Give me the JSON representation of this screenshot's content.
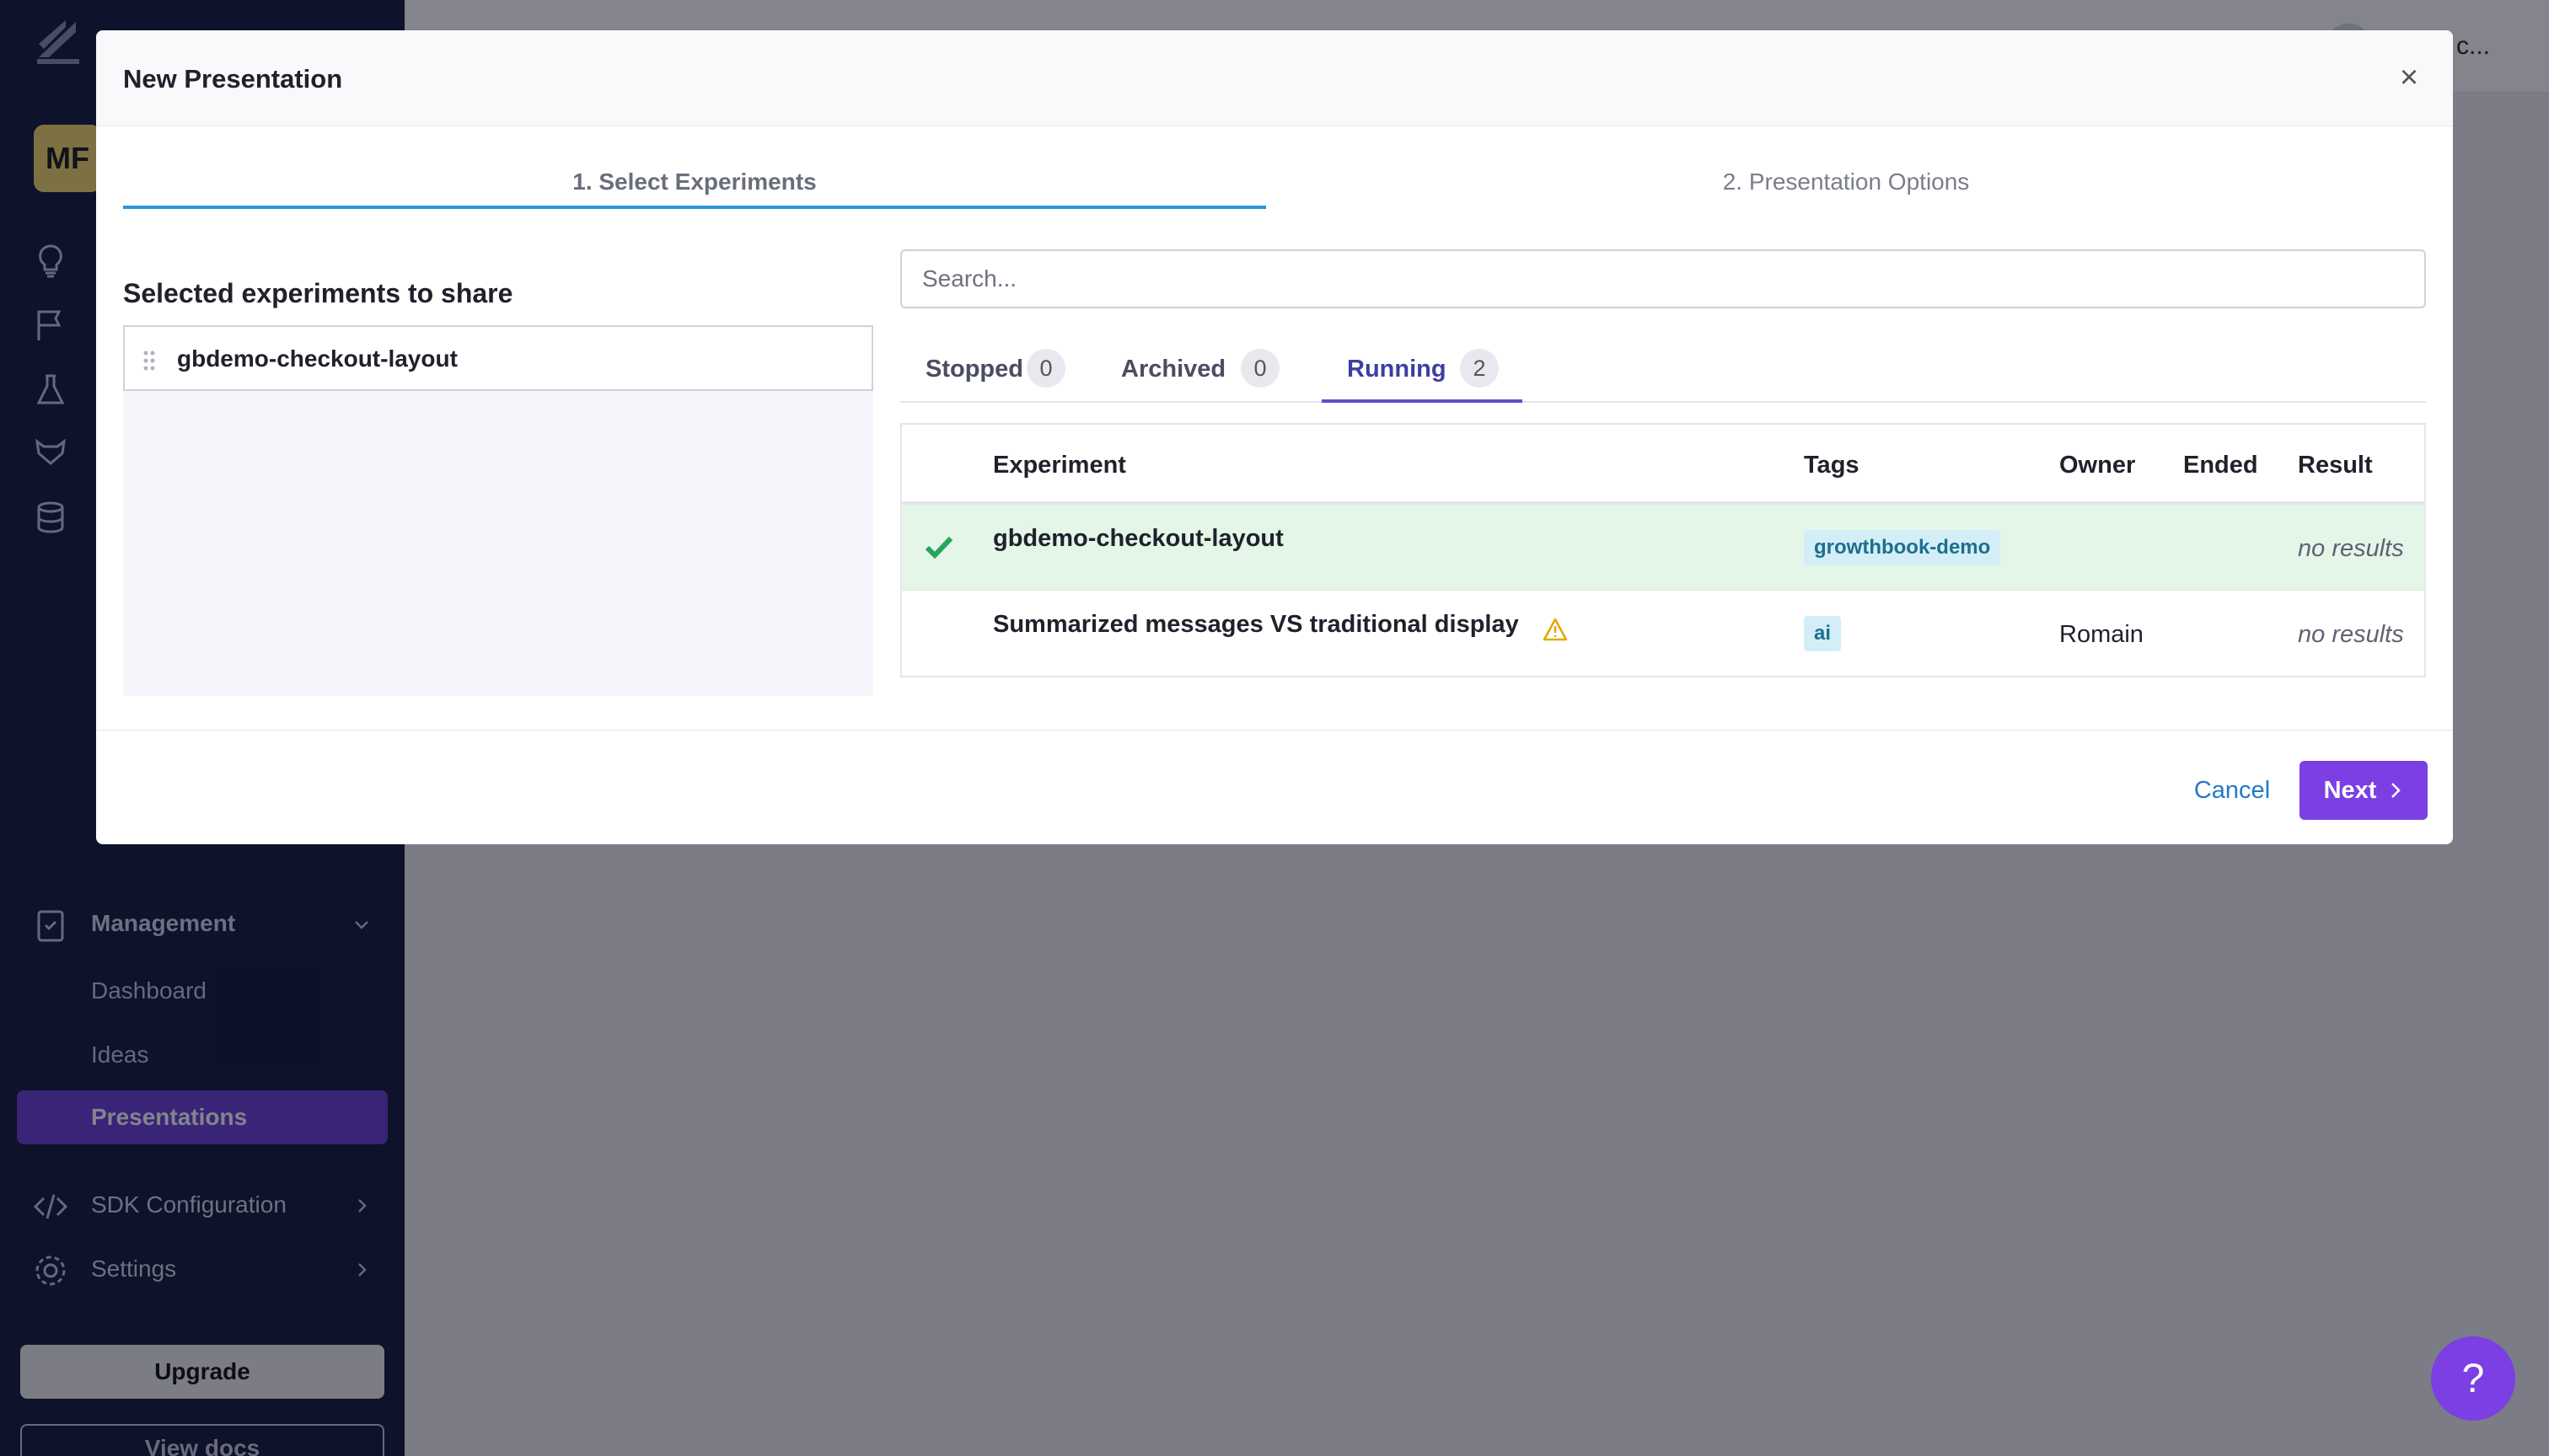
{
  "app": {
    "org_name": "c...",
    "avatar_initials": "MF",
    "sidebar": {
      "management_label": "Management",
      "management_items": [
        "Dashboard",
        "Ideas",
        "Presentations"
      ],
      "active_item": "Presentations",
      "sdk_label": "SDK Configuration",
      "settings_label": "Settings",
      "upgrade_label": "Upgrade",
      "docs_label": "View docs"
    },
    "help_label": "?"
  },
  "modal": {
    "title": "New Presentation",
    "close_label": "×",
    "steps": [
      "1. Select Experiments",
      "2. Presentation Options"
    ],
    "active_step": 0,
    "selected": {
      "title": "Selected experiments to share",
      "items": [
        "gbdemo-checkout-layout"
      ]
    },
    "search": {
      "placeholder": "Search...",
      "value": ""
    },
    "tabs": [
      {
        "label": "Stopped",
        "count": "0"
      },
      {
        "label": "Archived",
        "count": "0"
      },
      {
        "label": "Running",
        "count": "2"
      }
    ],
    "active_tab": "Running",
    "table": {
      "columns": [
        "Experiment",
        "Tags",
        "Owner",
        "Ended",
        "Result"
      ],
      "rows": [
        {
          "name": "gbdemo-checkout-layout",
          "tag": "growthbook-demo",
          "owner": "",
          "ended": "",
          "result": "no results",
          "selected": true,
          "warning": false
        },
        {
          "name": "Summarized messages VS traditional display",
          "tag": "ai",
          "owner": "Romain",
          "ended": "",
          "result": "no results",
          "selected": false,
          "warning": true
        }
      ]
    },
    "footer": {
      "cancel_label": "Cancel",
      "next_label": "Next"
    }
  },
  "colors": {
    "accent": "#7b3fe4",
    "step_underline": "#2b95d8",
    "selected_row": "#e3f6e8",
    "check": "#27a55a",
    "warning": "#e0a800",
    "tag_bg": "#d3eef7",
    "sidebar_bg": "#141a3a"
  }
}
